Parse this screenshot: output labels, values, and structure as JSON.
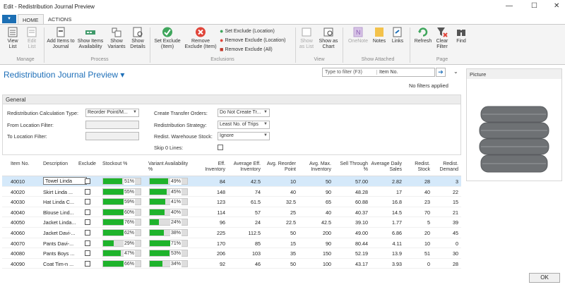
{
  "window": {
    "title": "Edit - Redistribution Journal Preview"
  },
  "ribbon": {
    "tabs": [
      "HOME",
      "ACTIONS"
    ],
    "buttons": {
      "view_list": "View List",
      "edit_list": "Edit List",
      "add_items": "Add Items to Journal",
      "show_items_avail": "Show Items Availability",
      "show_variants": "Show Variants",
      "show_details": "Show Details",
      "set_exclude_item": "Set Exclude (Item)",
      "remove_exclude_item": "Remove Exclude (Item)",
      "set_exclude_loc": "Set Exclude (Location)",
      "remove_exclude_loc": "Remove Exclude (Location)",
      "remove_exclude_all": "Remove Exclude (All)",
      "show_as_list": "Show as List",
      "show_as_chart": "Show as Chart",
      "onenote": "OneNote",
      "notes": "Notes",
      "links": "Links",
      "refresh": "Refresh",
      "clear_filter": "Clear Filter",
      "find": "Find"
    },
    "groups": [
      "Manage",
      "Process",
      "Exclusions",
      "View",
      "Show Attached",
      "Page"
    ]
  },
  "page": {
    "title": "Redistribution Journal Preview ▾",
    "filter_placeholder": "Type to filter (F3)",
    "filter_field": "Item No.",
    "no_filters": "No filters applied"
  },
  "picture": {
    "title": "Picture"
  },
  "general": {
    "title": "General",
    "calc_type_label": "Redistribution Calculation Type:",
    "calc_type_value": "Reorder Point/M...",
    "from_loc_label": "From Location Filter:",
    "to_loc_label": "To Location Filter:",
    "transfer_orders_label": "Create Transfer Orders:",
    "transfer_orders_value": "Do Not Create Tr...",
    "strategy_label": "Redistribution Strategy:",
    "strategy_value": "Least No. of Trips",
    "whse_label": "Redist. Warehouse Stock:",
    "whse_value": "Ignore",
    "skip_label": "Skip 0 Lines:"
  },
  "table": {
    "headers": [
      "Item No.",
      "Description",
      "Exclude",
      "Stockout %",
      "Variant Availability %",
      "Eff. Inventory",
      "Average Eff. Inventory",
      "Avg. Reorder Point",
      "Avg. Max. Inventory",
      "Sell Through %",
      "Average Daily Sales",
      "Redist. Stock",
      "Redist. Demand"
    ],
    "rows": [
      {
        "no": "40010",
        "desc": "Towel Linda",
        "stockout": "51%",
        "so": 51,
        "variant": "49%",
        "va": 49,
        "eff": "84",
        "avg_eff": "42.5",
        "reorder": "10",
        "max": "50",
        "sell": "57.00",
        "daily": "2.82",
        "stock": "28",
        "demand": "3"
      },
      {
        "no": "40020",
        "desc": "Skirt Linda ...",
        "stockout": "55%",
        "so": 55,
        "variant": "45%",
        "va": 45,
        "eff": "148",
        "avg_eff": "74",
        "reorder": "40",
        "max": "90",
        "sell": "48.28",
        "daily": "17",
        "stock": "40",
        "demand": "22"
      },
      {
        "no": "40030",
        "desc": "Hat Linda C...",
        "stockout": "59%",
        "so": 59,
        "variant": "41%",
        "va": 41,
        "eff": "123",
        "avg_eff": "61.5",
        "reorder": "32.5",
        "max": "65",
        "sell": "60.88",
        "daily": "16.8",
        "stock": "23",
        "demand": "15"
      },
      {
        "no": "40040",
        "desc": "Blouse Lind...",
        "stockout": "60%",
        "so": 60,
        "variant": "40%",
        "va": 40,
        "eff": "114",
        "avg_eff": "57",
        "reorder": "25",
        "max": "40",
        "sell": "40.37",
        "daily": "14.5",
        "stock": "70",
        "demand": "21"
      },
      {
        "no": "40050",
        "desc": "Jacket Linda...",
        "stockout": "76%",
        "so": 76,
        "variant": "24%",
        "va": 24,
        "eff": "96",
        "avg_eff": "24",
        "reorder": "22.5",
        "max": "42.5",
        "sell": "39.10",
        "daily": "1.77",
        "stock": "5",
        "demand": "39"
      },
      {
        "no": "40060",
        "desc": "Jacket Davi-...",
        "stockout": "62%",
        "so": 62,
        "variant": "38%",
        "va": 38,
        "eff": "225",
        "avg_eff": "112.5",
        "reorder": "50",
        "max": "200",
        "sell": "49.00",
        "daily": "6.86",
        "stock": "20",
        "demand": "45"
      },
      {
        "no": "40070",
        "desc": "Pants Davi-...",
        "stockout": "29%",
        "so": 29,
        "variant": "71%",
        "va": 71,
        "eff": "170",
        "avg_eff": "85",
        "reorder": "15",
        "max": "90",
        "sell": "80.44",
        "daily": "4.11",
        "stock": "10",
        "demand": "0"
      },
      {
        "no": "40080",
        "desc": "Pants Boys ...",
        "stockout": "47%",
        "so": 47,
        "variant": "53%",
        "va": 53,
        "eff": "206",
        "avg_eff": "103",
        "reorder": "35",
        "max": "150",
        "sell": "52.19",
        "daily": "13.9",
        "stock": "51",
        "demand": "30"
      },
      {
        "no": "40090",
        "desc": "Coat Tim-n ...",
        "stockout": "66%",
        "so": 66,
        "variant": "34%",
        "va": 34,
        "eff": "92",
        "avg_eff": "46",
        "reorder": "50",
        "max": "100",
        "sell": "43.17",
        "daily": "3.93",
        "stock": "0",
        "demand": "28"
      }
    ]
  },
  "footer": {
    "ok": "OK"
  },
  "colors": {
    "accent": "#1e6fb8",
    "bar": "#1eb32b",
    "selected": "#d5e9fa"
  }
}
